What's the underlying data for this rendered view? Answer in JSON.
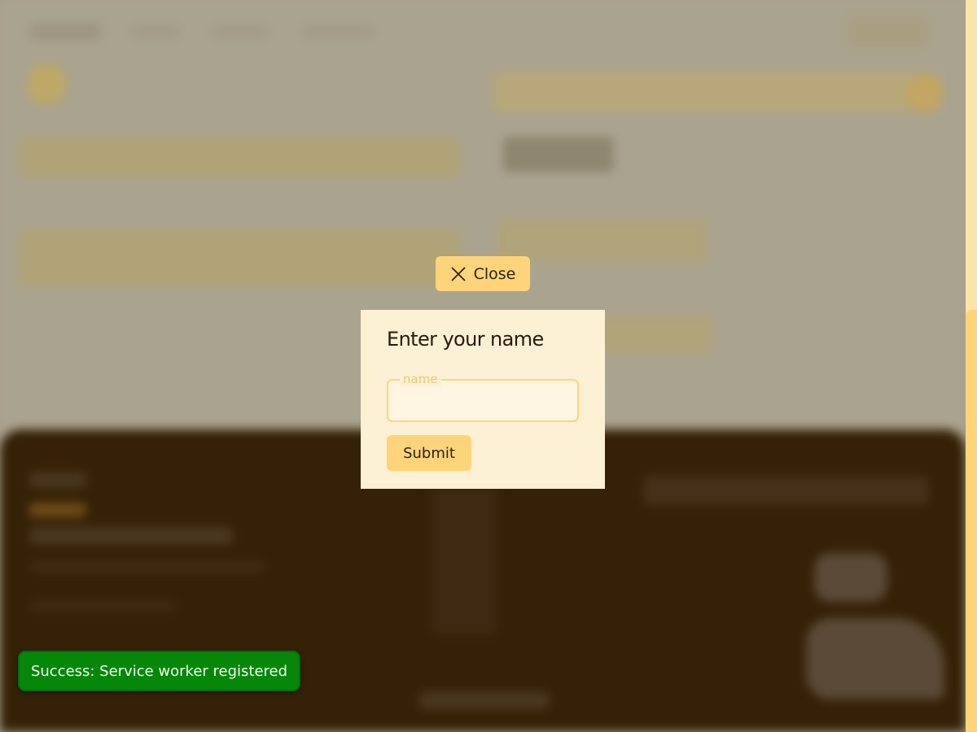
{
  "dialog": {
    "close_label": "Close",
    "title": "Enter your name",
    "field_label": "name",
    "field_value": "",
    "submit_label": "Submit"
  },
  "toast": {
    "message": "Success: Service worker registered"
  },
  "colors": {
    "accent": "#fed47b",
    "dialog_bg": "#fcf0d5",
    "footer_bg": "#352107",
    "toast_bg": "#06870a"
  },
  "icons": {
    "close": "close-icon"
  }
}
